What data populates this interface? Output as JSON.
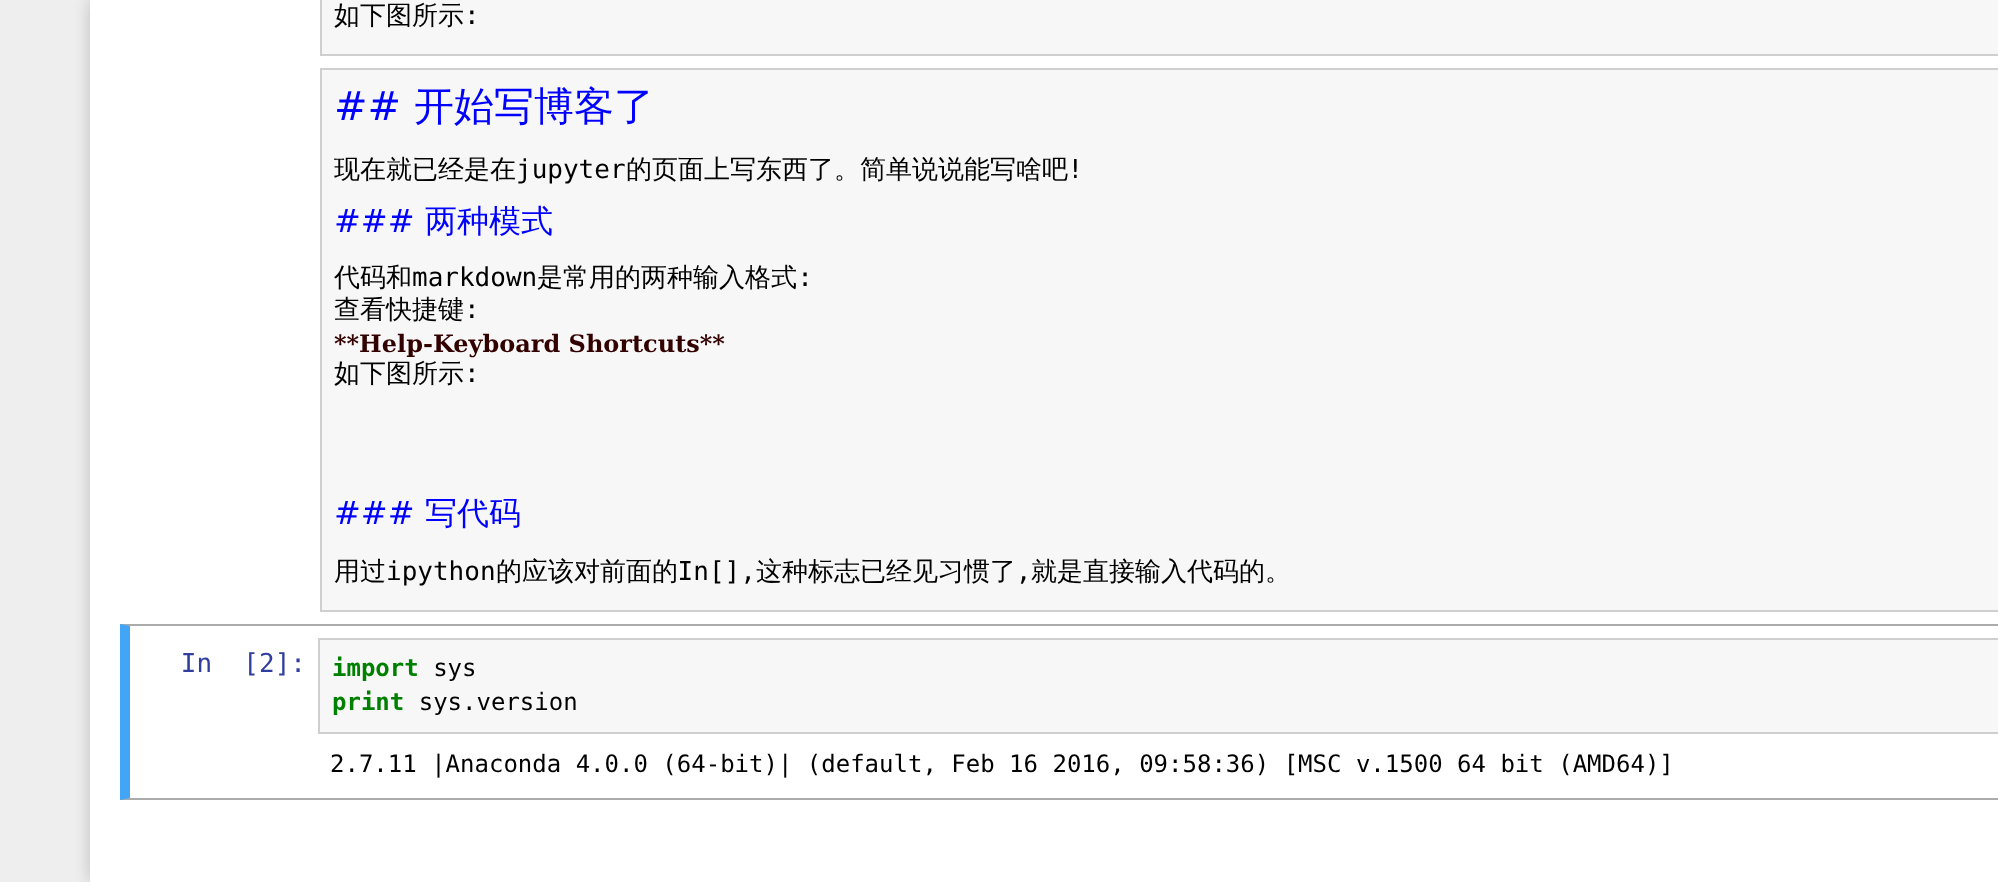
{
  "cells": [
    {
      "kind": "markdown",
      "selected": false,
      "lines": [
        {
          "kind": "text",
          "text": "如下图所示:"
        }
      ]
    },
    {
      "kind": "markdown",
      "selected": false,
      "lines": [
        {
          "kind": "h2",
          "text": "## 开始写博客了"
        },
        {
          "kind": "text",
          "text": "现在就已经是在jupyter的页面上写东西了。简单说说能写啥吧!"
        },
        {
          "kind": "h3",
          "text": "### 两种模式"
        },
        {
          "kind": "tight",
          "text": "代码和markdown是常用的两种输入格式:"
        },
        {
          "kind": "tight",
          "text": "查看快捷键:"
        },
        {
          "kind": "bold",
          "text": "**Help-Keyboard Shortcuts**"
        },
        {
          "kind": "tight",
          "text": "如下图所示:"
        },
        {
          "kind": "blank"
        },
        {
          "kind": "h3",
          "text": "### 写代码"
        },
        {
          "kind": "text",
          "text": "用过ipython的应该对前面的In[],这种标志已经见习惯了,就是直接输入代码的。"
        }
      ]
    },
    {
      "kind": "code",
      "selected": true,
      "prompt": "In  [2]:",
      "code": [
        [
          {
            "kind": "keyword",
            "text": "import"
          },
          {
            "kind": "plain",
            "text": " sys"
          }
        ],
        [
          {
            "kind": "keyword",
            "text": "print"
          },
          {
            "kind": "plain",
            "text": " sys.version"
          }
        ]
      ],
      "output": "2.7.11 |Anaconda 4.0.0 (64-bit)| (default, Feb 16 2016, 09:58:36) [MSC v.1500 64 bit (AMD64)]"
    }
  ]
}
